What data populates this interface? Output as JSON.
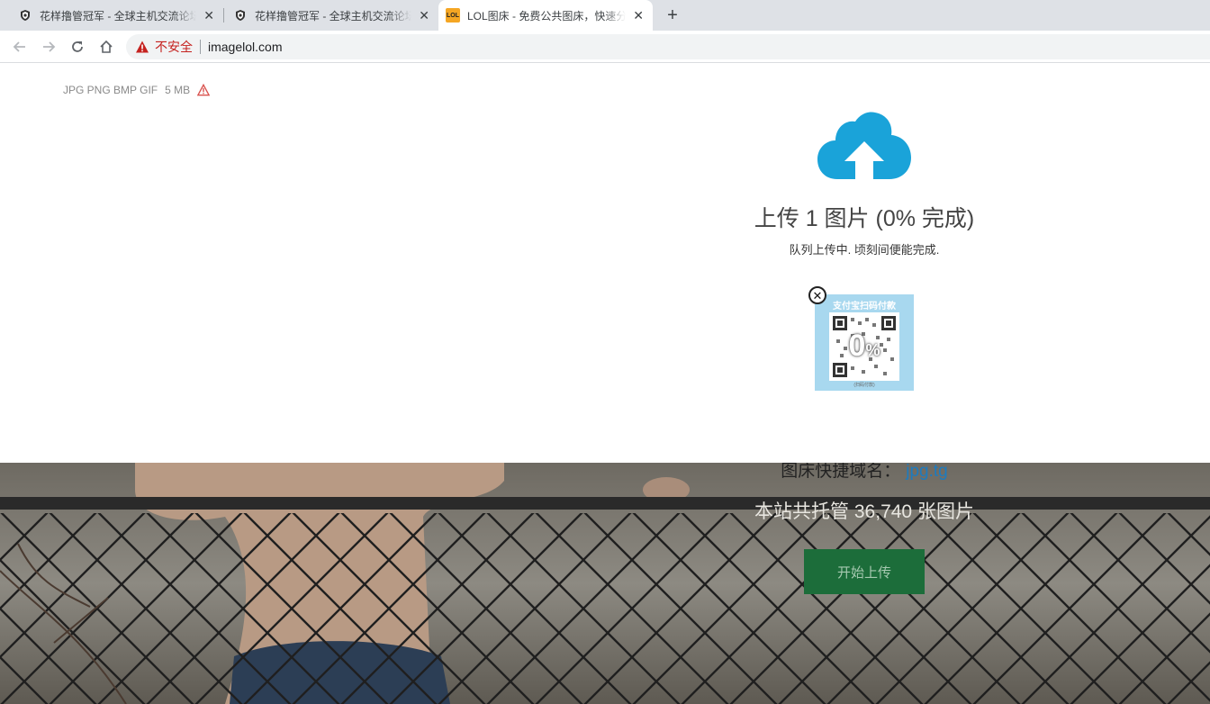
{
  "browser": {
    "tabs": [
      {
        "title": "花样撸管冠军 - 全球主机交流论坛",
        "favicon": "shield-favicon",
        "active": false
      },
      {
        "title": "花样撸管冠军 - 全球主机交流论坛",
        "favicon": "shield-favicon",
        "active": false
      },
      {
        "title": "LOL图床 - 免费公共图床，快速分享",
        "favicon": "lol-favicon",
        "favicon_text": "LOL",
        "active": true
      }
    ],
    "new_tab_label": "+",
    "close_glyph": "✕",
    "address": {
      "security_label": "不安全",
      "url": "imagelol.com"
    }
  },
  "upload": {
    "formats": "JPG PNG BMP GIF",
    "max_size": "5 MB",
    "title": "上传 1 图片 (0% 完成)",
    "subtitle": "队列上传中. 顷刻间便能完成.",
    "thumbnail": {
      "caption": "支付宝扫码付款",
      "percent": "0",
      "percent_sign": "%",
      "footer": "(扫码付款)"
    },
    "remove_glyph": "✕"
  },
  "background": {
    "domain_label": "图床快捷域名：",
    "domain_link": "jpg.tg",
    "hosted_count_text": "本站共托管 36,740 张图片",
    "start_button": "开始上传"
  },
  "colors": {
    "accent_cloud": "#1aa3d9",
    "insecure_red": "#c5221f",
    "start_button_bg": "#1c6d3a",
    "link_blue": "#1d7bbf"
  }
}
